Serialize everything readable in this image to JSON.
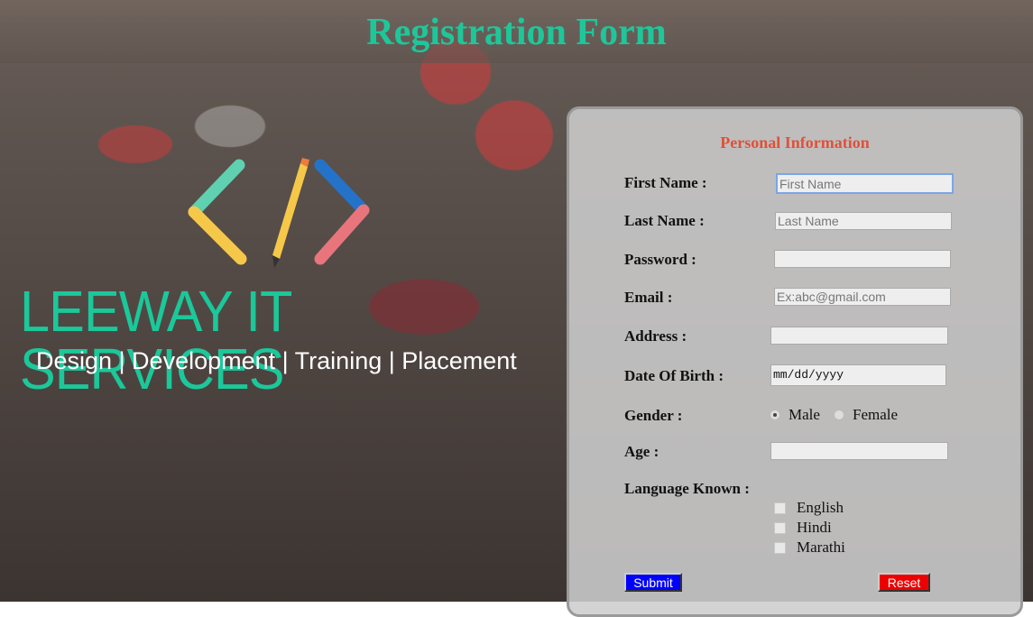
{
  "page": {
    "title": "Registration Form"
  },
  "branding": {
    "logo_icon": "code-pencil-icon",
    "name": "LEEWAY IT SERVICES",
    "tagline": "Design | Development | Training | Placement",
    "accent": "#1ec79a"
  },
  "form": {
    "section_title": "Personal Information",
    "first_name": {
      "label": "First Name :",
      "placeholder": "First Name",
      "value": ""
    },
    "last_name": {
      "label": "Last Name :",
      "placeholder": "Last Name",
      "value": ""
    },
    "password": {
      "label": "Password :",
      "value": ""
    },
    "email": {
      "label": "Email :",
      "placeholder": "Ex:abc@gmail.com",
      "value": ""
    },
    "address": {
      "label": "Address :",
      "value": ""
    },
    "dob": {
      "label": "Date Of Birth :",
      "value": "mm/dd/yyyy"
    },
    "gender": {
      "label": "Gender :",
      "options": [
        {
          "label": "Male",
          "selected": true
        },
        {
          "label": "Female",
          "selected": false
        }
      ]
    },
    "age": {
      "label": "Age :",
      "value": ""
    },
    "languages": {
      "label": "Language Known :",
      "options": [
        {
          "label": "English",
          "checked": false
        },
        {
          "label": "Hindi",
          "checked": false
        },
        {
          "label": "Marathi",
          "checked": false
        }
      ]
    },
    "submit_label": "Submit",
    "reset_label": "Reset",
    "colors": {
      "section": "#e1503a",
      "submit": "#0000ff",
      "reset": "#ee0000"
    }
  }
}
